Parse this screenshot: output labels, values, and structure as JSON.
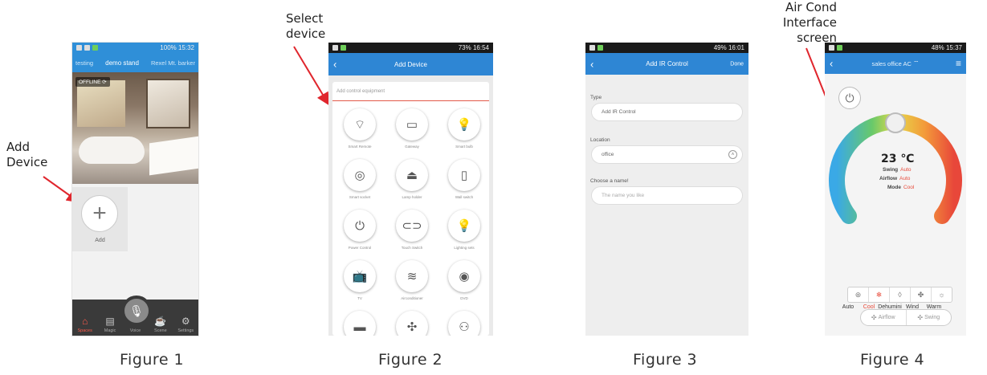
{
  "annotations": {
    "add_device": [
      "Add",
      "Device"
    ],
    "select_device": [
      "Select",
      "device"
    ],
    "aircon_interface": [
      "Air Cond",
      "Interface",
      "screen"
    ]
  },
  "captions": [
    "Figure 1",
    "Figure 2",
    "Figure 3",
    "Figure 4"
  ],
  "colors": {
    "primary": "#2e86d4",
    "accent": "#e84a3a",
    "annotation_arrow": "#e0262d"
  },
  "fig1": {
    "status": {
      "right": "100% 15:32"
    },
    "tabs": [
      "testing",
      "demo stand",
      "Rexel Mt. barker"
    ],
    "active_tab": "demo stand",
    "offline_badge": "OFFLINE",
    "add_label": "Add",
    "add_icon": "+",
    "nav": [
      {
        "label": "Spaces",
        "icon": "home-icon",
        "glyph": "⌂",
        "active": true
      },
      {
        "label": "Magic",
        "icon": "magic-box-icon",
        "glyph": "▤",
        "active": false
      },
      {
        "label": "Voice",
        "icon": "microphone-icon",
        "glyph": "🎙",
        "active": false
      },
      {
        "label": "Scene",
        "icon": "coffee-cup-icon",
        "glyph": "☕",
        "active": false
      },
      {
        "label": "Settings",
        "icon": "gear-icon",
        "glyph": "⚙",
        "active": false
      }
    ]
  },
  "fig2": {
    "status": {
      "right": "73% 16:54"
    },
    "title": "Add Device",
    "input_placeholder": "Add control equipment",
    "devices": [
      {
        "label": "Smart Remote",
        "icon": "wifi-remote-icon",
        "glyph": "⌔"
      },
      {
        "label": "Gateway",
        "icon": "gateway-icon",
        "glyph": "▭"
      },
      {
        "label": "Smart bulb",
        "icon": "bulb-icon",
        "glyph": "💡"
      },
      {
        "label": "Smart socket",
        "icon": "socket-icon",
        "glyph": "◎"
      },
      {
        "label": "Lamp holder",
        "icon": "lamp-holder-icon",
        "glyph": "⏏"
      },
      {
        "label": "Wall switch",
        "icon": "wall-switch-icon",
        "glyph": "▯"
      },
      {
        "label": "Power Control",
        "icon": "power-icon",
        "glyph": "⏻"
      },
      {
        "label": "Touch Switch",
        "icon": "toggle-icon",
        "glyph": "⊂⊃"
      },
      {
        "label": "Lighting sets",
        "icon": "lighting-icon",
        "glyph": "💡"
      },
      {
        "label": "TV",
        "icon": "tv-icon",
        "glyph": "📺"
      },
      {
        "label": "Airconditioner",
        "icon": "aircon-icon",
        "glyph": "≋"
      },
      {
        "label": "DVD",
        "icon": "disc-icon",
        "glyph": "◉"
      },
      {
        "label": "",
        "icon": "device-icon",
        "glyph": "▬"
      },
      {
        "label": "",
        "icon": "fan-icon",
        "glyph": "✣"
      },
      {
        "label": "",
        "icon": "camera-icon",
        "glyph": "⚇"
      }
    ]
  },
  "fig3": {
    "status": {
      "right": "49% 16:01"
    },
    "title": "Add IR Control",
    "done": "Done",
    "type_label": "Type",
    "type_value": "Add IR Control",
    "location_label": "Location",
    "location_value": "office",
    "name_label": "Choose a name!",
    "name_placeholder": "The name you like"
  },
  "fig4": {
    "status": {
      "right": "48% 15:37"
    },
    "title": "sales office AC",
    "temperature": "23 ℃",
    "temperature_level_fraction": 0.5,
    "swing_label": "Swing",
    "swing_value": "Auto",
    "airflow_label": "Airflow",
    "airflow_value": "Auto",
    "mode_label": "Mode",
    "mode_value": "Cool",
    "modes": [
      {
        "label": "Auto",
        "icon": "auto-icon",
        "glyph": "⊛",
        "active": false
      },
      {
        "label": "Cool",
        "icon": "snowflake-icon",
        "glyph": "❄",
        "active": true
      },
      {
        "label": "Dehumini fier",
        "icon": "droplet-icon",
        "glyph": "◊",
        "active": false
      },
      {
        "label": "Wind",
        "icon": "fan-icon",
        "glyph": "✤",
        "active": false
      },
      {
        "label": "Warm",
        "icon": "sun-icon",
        "glyph": "☼",
        "active": false
      }
    ],
    "airflow_button": "Airflow",
    "swing_button": "Swing"
  }
}
